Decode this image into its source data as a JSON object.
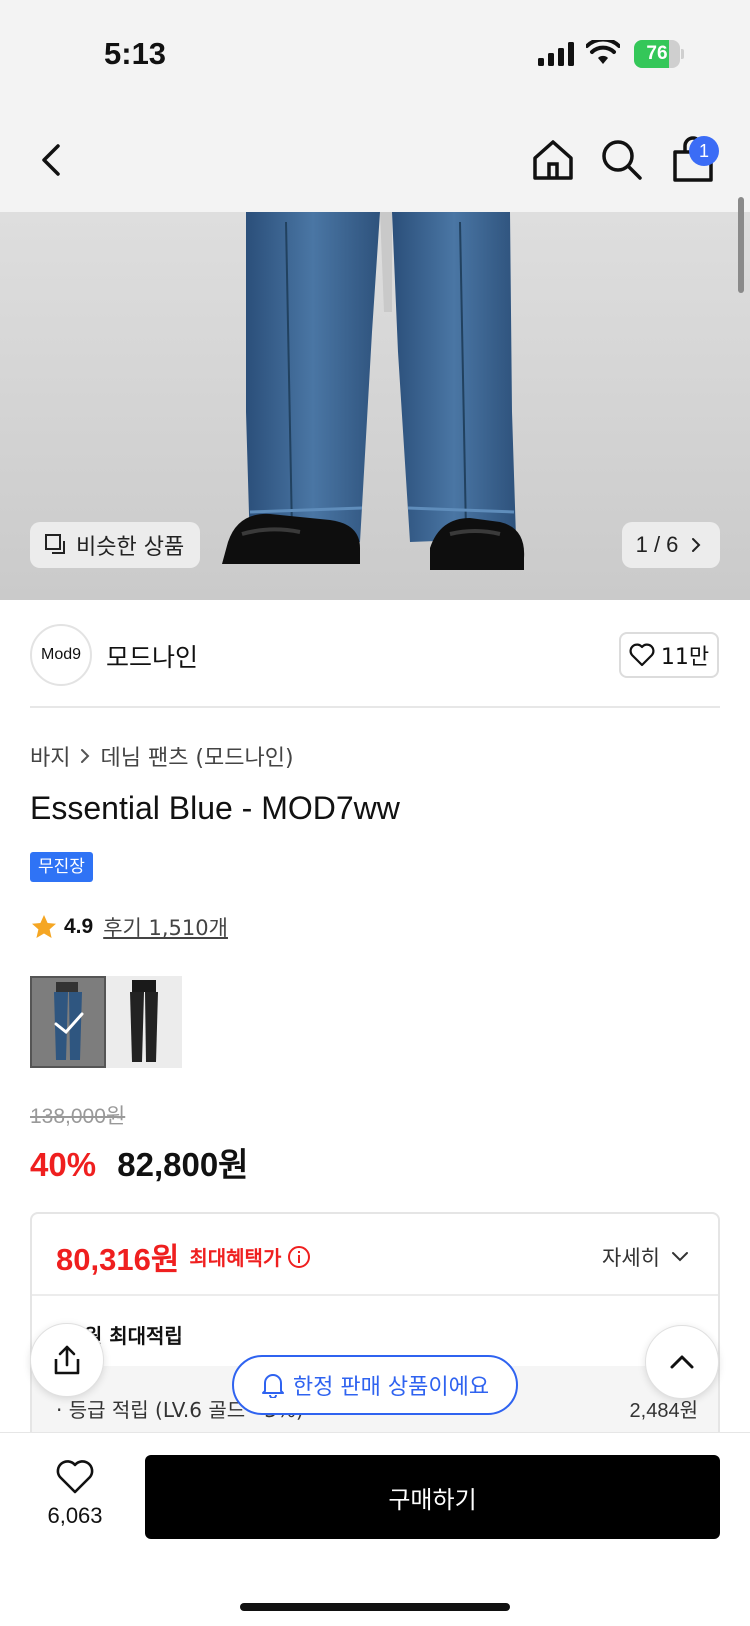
{
  "status_bar": {
    "time": "5:13",
    "battery_percent": "76",
    "battery_level": 0.76,
    "battery_color": "#34c759",
    "icons": [
      "cellular-signal-icon",
      "wifi-icon",
      "battery-charging-icon"
    ]
  },
  "nav": {
    "icons": [
      "back-chevron-icon",
      "home-icon",
      "search-icon",
      "shopping-bag-icon"
    ],
    "cart_badge": "1",
    "badge_color": "#3b6cf6"
  },
  "hero": {
    "similar_button": "비슷한 상품",
    "page_indicator": "1 / 6",
    "similar_icon": "similar-items-icon",
    "next_icon": "chevron-right-icon"
  },
  "brand": {
    "logo_text": "Mod9",
    "name": "모드나인",
    "likes": "11만"
  },
  "product": {
    "breadcrumb": [
      "바지",
      "데님 팬츠 (모드나인)"
    ],
    "title": "Essential Blue - MOD7ww",
    "tag": "무진장",
    "tag_color": "#2f73f5",
    "rating": "4.9",
    "reviews": "후기 1,510개",
    "color_options": [
      "blue",
      "black"
    ],
    "selected_option": "blue",
    "original_price": "138,000원",
    "discount": "40%",
    "price": "82,800원",
    "accent_color": "#ef1f1f"
  },
  "benefit": {
    "max_price": "80,316원",
    "max_label": "최대혜택가",
    "detail_link": "자세히",
    "points_title": "67원 최대적립",
    "grade_label": "· 등급 적립 (LV.6 골드 · 3%)",
    "grade_value": "2,484원"
  },
  "floating": {
    "share_icon": "share-icon",
    "top_icon": "chevron-up-icon",
    "limited_label": "한정 판매 상품이에요",
    "limited_icon": "bell-icon",
    "limited_color": "#2f63f0"
  },
  "bottom": {
    "wish_count": "6,063",
    "buy_label": "구매하기"
  }
}
